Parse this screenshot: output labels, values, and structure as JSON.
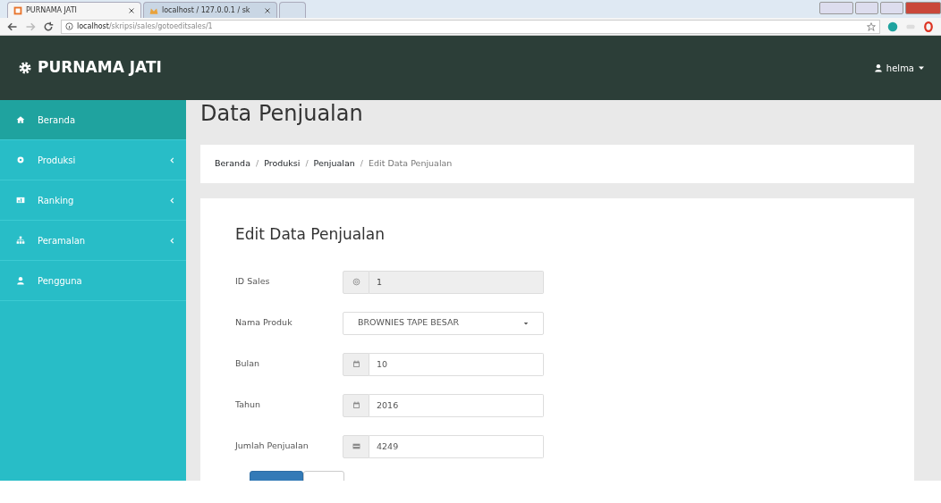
{
  "browser": {
    "tabs": [
      {
        "title": "PURNAMA JATI",
        "selected": true
      },
      {
        "title": "localhost / 127.0.0.1 / sk",
        "selected": false
      }
    ],
    "address": {
      "host": "localhost",
      "path": "/skripsi/sales/gotoeditsales/1"
    }
  },
  "navbar": {
    "brand": "PURNAMA JATI",
    "user": "helma"
  },
  "sidebar": {
    "items": [
      {
        "label": "Beranda",
        "selected": true,
        "submenu": false
      },
      {
        "label": "Produksi",
        "selected": false,
        "submenu": true
      },
      {
        "label": "Ranking",
        "selected": false,
        "submenu": true
      },
      {
        "label": "Peramalan",
        "selected": false,
        "submenu": true
      },
      {
        "label": "Pengguna",
        "selected": false,
        "submenu": false
      }
    ]
  },
  "page_title": "Data Penjualan",
  "breadcrumb_separator": "/",
  "breadcrumb": [
    {
      "label": "Beranda",
      "selected": false
    },
    {
      "label": "Produksi",
      "selected": false
    },
    {
      "label": "Penjualan",
      "selected": false
    },
    {
      "label": "Edit Data Penjualan",
      "selected": true
    }
  ],
  "form": {
    "title": "Edit Data Penjualan",
    "fields": [
      {
        "label": "ID Sales",
        "kind": "at",
        "value": "1",
        "disabled": true
      },
      {
        "label": "Nama Produk",
        "kind": "select",
        "value": "BROWNIES TAPE BESAR",
        "disabled": false
      },
      {
        "label": "Bulan",
        "kind": "calendar",
        "value": "10",
        "disabled": false
      },
      {
        "label": "Tahun",
        "kind": "calendar",
        "value": "2016",
        "disabled": false
      },
      {
        "label": "Jumlah Penjualan",
        "kind": "card",
        "value": "4249",
        "disabled": false
      }
    ],
    "buttons": [
      {
        "kind": "primary"
      },
      {
        "kind": "default"
      }
    ]
  }
}
